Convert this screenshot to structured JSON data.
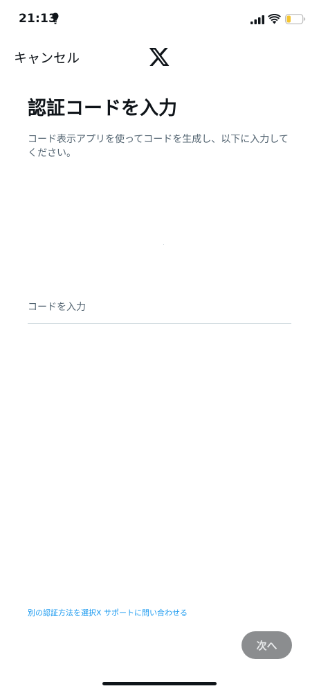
{
  "status_bar": {
    "time": "21:13"
  },
  "nav": {
    "cancel_label": "キャンセル",
    "logo_icon": "x-logo-icon"
  },
  "main": {
    "title": "認証コードを入力",
    "description": "コード表示アプリを使ってコードを生成し、以下に入力してください。",
    "code_placeholder": "コードを入力"
  },
  "footer": {
    "choose_method_link": "別の認証方法を選択",
    "support_link": "X サポートに問い合わせる",
    "next_label": "次へ"
  },
  "colors": {
    "link": "#1d9bf0",
    "button_disabled": "#8b8d8f",
    "battery_low": "#f4c430"
  }
}
